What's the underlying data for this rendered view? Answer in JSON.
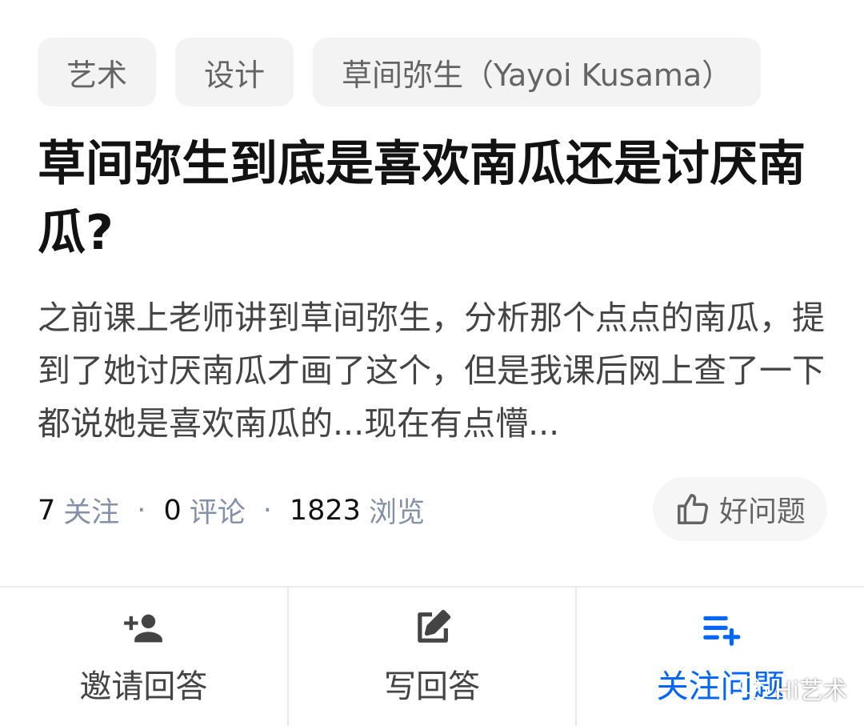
{
  "topics": [
    "艺术",
    "设计",
    "草间弥生（Yayoi Kusama）"
  ],
  "question": {
    "title": "草间弥生到底是喜欢南瓜还是讨厌南瓜?",
    "excerpt": "之前课上老师讲到草间弥生，分析那个点点的南瓜，提到了她讨厌南瓜才画了这个，但是我课后网上查了一下都说她是喜欢南瓜的...现在有点懵..."
  },
  "stats": {
    "follow_count": "7",
    "follow_label": "关注",
    "comment_count": "0",
    "comment_label": "评论",
    "view_count": "1823",
    "view_label": "浏览",
    "separator": "·"
  },
  "good_question": {
    "label": "好问题",
    "icon": "thumbs-up-icon"
  },
  "actions": [
    {
      "label": "邀请回答",
      "icon": "add-person-icon"
    },
    {
      "label": "写回答",
      "icon": "edit-icon"
    },
    {
      "label": "关注问题",
      "icon": "playlist-add-icon"
    }
  ],
  "watermark": {
    "text": "Hi艺术",
    "icon": "wechat-icon"
  },
  "colors": {
    "accent": "#0066ff",
    "text": "#121212",
    "muted": "#8590a6",
    "chip_bg": "#f3f3f3"
  }
}
